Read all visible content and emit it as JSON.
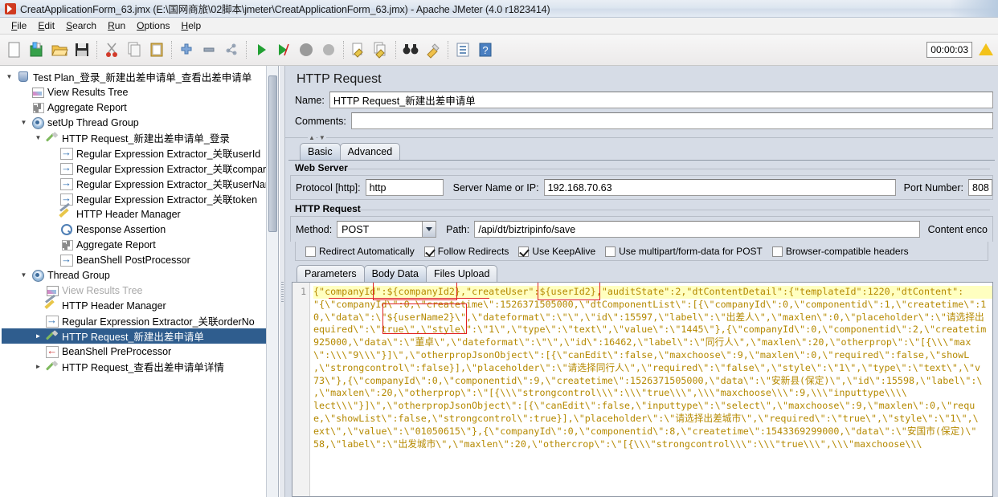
{
  "window": {
    "title": "CreatApplicationForm_63.jmx (E:\\国网商旅\\02脚本\\jmeter\\CreatApplicationForm_63.jmx) - Apache JMeter (4.0 r1823414)",
    "app_icon": "jmeter-icon"
  },
  "menubar": {
    "items": [
      {
        "label": "File",
        "mnemonic": "F"
      },
      {
        "label": "Edit",
        "mnemonic": "E"
      },
      {
        "label": "Search",
        "mnemonic": "S"
      },
      {
        "label": "Run",
        "mnemonic": "R"
      },
      {
        "label": "Options",
        "mnemonic": "O"
      },
      {
        "label": "Help",
        "mnemonic": "H"
      }
    ]
  },
  "toolbar": {
    "buttons": [
      {
        "name": "new-icon",
        "glyph": "page"
      },
      {
        "name": "templates-icon",
        "glyph": "templates"
      },
      {
        "name": "open-icon",
        "glyph": "folder"
      },
      {
        "name": "save-icon",
        "glyph": "floppy"
      },
      {
        "name": "cut-icon",
        "glyph": "scissors"
      },
      {
        "name": "copy-icon",
        "glyph": "copy"
      },
      {
        "name": "paste-icon",
        "glyph": "clipboard"
      },
      {
        "name": "expand-all-icon",
        "glyph": "plus"
      },
      {
        "name": "collapse-all-icon",
        "glyph": "minus"
      },
      {
        "name": "toggle-icon",
        "glyph": "toggle"
      },
      {
        "name": "start-icon",
        "glyph": "play"
      },
      {
        "name": "start-no-pauses-icon",
        "glyph": "play-no-pause"
      },
      {
        "name": "stop-icon",
        "glyph": "stop"
      },
      {
        "name": "shutdown-icon",
        "glyph": "shutdown"
      },
      {
        "name": "clear-icon",
        "glyph": "broom-page"
      },
      {
        "name": "clear-all-icon",
        "glyph": "broom-pages"
      },
      {
        "name": "search-icon",
        "glyph": "binoculars"
      },
      {
        "name": "reset-search-icon",
        "glyph": "brush"
      },
      {
        "name": "function-helper-icon",
        "glyph": "list"
      },
      {
        "name": "help-icon",
        "glyph": "question"
      }
    ],
    "timer": "00:00:03",
    "warning_icon": "warning-triangle-icon"
  },
  "tree": {
    "nodes": [
      {
        "label": "Test Plan_登录_新建出差申请单_查看出差申请单",
        "indent": 0,
        "twisty": "down",
        "icon": "test-plan-icon",
        "selected": false,
        "disabled": false
      },
      {
        "label": "View Results Tree",
        "indent": 1,
        "twisty": "none",
        "icon": "view-results-tree-icon",
        "selected": false,
        "disabled": false
      },
      {
        "label": "Aggregate Report",
        "indent": 1,
        "twisty": "none",
        "icon": "aggregate-report-icon",
        "selected": false,
        "disabled": false
      },
      {
        "label": "setUp Thread Group",
        "indent": 1,
        "twisty": "down",
        "icon": "thread-group-icon",
        "selected": false,
        "disabled": false
      },
      {
        "label": "HTTP Request_新建出差申请单_登录",
        "indent": 2,
        "twisty": "down",
        "icon": "http-request-icon",
        "selected": false,
        "disabled": false
      },
      {
        "label": "Regular Expression Extractor_关联userId",
        "indent": 3,
        "twisty": "none",
        "icon": "post-processor-icon",
        "selected": false,
        "disabled": false
      },
      {
        "label": "Regular Expression Extractor_关联companyId",
        "indent": 3,
        "twisty": "none",
        "icon": "post-processor-icon",
        "selected": false,
        "disabled": false
      },
      {
        "label": "Regular Expression Extractor_关联userName",
        "indent": 3,
        "twisty": "none",
        "icon": "post-processor-icon",
        "selected": false,
        "disabled": false
      },
      {
        "label": "Regular Expression Extractor_关联token",
        "indent": 3,
        "twisty": "none",
        "icon": "post-processor-icon",
        "selected": false,
        "disabled": false
      },
      {
        "label": "HTTP Header Manager",
        "indent": 3,
        "twisty": "none",
        "icon": "header-manager-icon",
        "selected": false,
        "disabled": false
      },
      {
        "label": "Response Assertion",
        "indent": 3,
        "twisty": "none",
        "icon": "assertion-icon",
        "selected": false,
        "disabled": false
      },
      {
        "label": "Aggregate Report",
        "indent": 3,
        "twisty": "none",
        "icon": "aggregate-report-icon",
        "selected": false,
        "disabled": false
      },
      {
        "label": "BeanShell PostProcessor",
        "indent": 3,
        "twisty": "none",
        "icon": "post-processor-icon",
        "selected": false,
        "disabled": false
      },
      {
        "label": "Thread Group",
        "indent": 1,
        "twisty": "down",
        "icon": "thread-group-icon",
        "selected": false,
        "disabled": false
      },
      {
        "label": "View Results Tree",
        "indent": 2,
        "twisty": "none",
        "icon": "view-results-tree-icon",
        "selected": false,
        "disabled": true
      },
      {
        "label": "HTTP Header Manager",
        "indent": 2,
        "twisty": "none",
        "icon": "header-manager-icon",
        "selected": false,
        "disabled": false
      },
      {
        "label": "Regular Expression Extractor_关联orderNo",
        "indent": 2,
        "twisty": "none",
        "icon": "post-processor-icon",
        "selected": false,
        "disabled": false
      },
      {
        "label": "HTTP Request_新建出差申请单",
        "indent": 2,
        "twisty": "right",
        "icon": "http-request-icon",
        "selected": true,
        "disabled": false
      },
      {
        "label": "BeanShell PreProcessor",
        "indent": 2,
        "twisty": "none",
        "icon": "pre-processor-icon",
        "selected": false,
        "disabled": false
      },
      {
        "label": "HTTP Request_查看出差申请单详情",
        "indent": 2,
        "twisty": "right",
        "icon": "http-request-icon",
        "selected": false,
        "disabled": false
      }
    ]
  },
  "panel": {
    "title": "HTTP Request",
    "name_label": "Name:",
    "name_value": "HTTP Request_新建出差申请单",
    "comments_label": "Comments:",
    "comments_value": "",
    "tabs": [
      {
        "label": "Basic",
        "active": true
      },
      {
        "label": "Advanced",
        "active": false
      }
    ],
    "web_server": {
      "section_title": "Web Server",
      "protocol_label": "Protocol [http]:",
      "protocol_value": "http",
      "server_label": "Server Name or IP:",
      "server_value": "192.168.70.63",
      "port_label": "Port Number:",
      "port_value": "808"
    },
    "http_request": {
      "section_title": "HTTP Request",
      "method_label": "Method:",
      "method_value": "POST",
      "path_label": "Path:",
      "path_value": "/api/dt/biztripinfo/save",
      "content_encoding_label": "Content enco"
    },
    "checkboxes": [
      {
        "label": "Redirect Automatically",
        "checked": false
      },
      {
        "label": "Follow Redirects",
        "checked": true
      },
      {
        "label": "Use KeepAlive",
        "checked": true
      },
      {
        "label": "Use multipart/form-data for POST",
        "checked": false
      },
      {
        "label": "Browser-compatible headers",
        "checked": false
      }
    ],
    "data_tabs": [
      {
        "label": "Parameters",
        "active": false
      },
      {
        "label": "Body Data",
        "active": true
      },
      {
        "label": "Files Upload",
        "active": false
      }
    ]
  },
  "body_editor": {
    "line_number": "1",
    "lines": [
      "{\"companyId\":${companyId2},\"createUser\":${userId2},\"auditState\":2,\"dtContentDetail\":{\"templateId\":1220,\"dtContent\":",
      "\"{\\\"companyId\\\":0,\\\"createtime\\\":1526371505000,\\\"dtComponentList\\\":[{\\\"companyId\\\":0,\\\"componentid\\\":1,\\\"createtime\\\":1",
      "0,\\\"data\\\":\\\"${userName2}\\\",\\\"dateformat\\\":\\\"\\\",\\\"id\\\":15597,\\\"label\\\":\\\"出差人\\\",\\\"maxlen\\\":0,\\\"placeholder\\\":\\\"请选择出",
      "equired\\\":\\\"true\\\",\\\"style\\\":\\\"1\\\",\\\"type\\\":\\\"text\\\",\\\"value\\\":\\\"1445\\\"},{\\\"companyId\\\":0,\\\"componentid\\\":2,\\\"createtim",
      "925000,\\\"data\\\":\\\"董卓\\\",\\\"dateformat\\\":\\\"\\\",\\\"id\\\":16462,\\\"label\\\":\\\"同行人\\\",\\\"maxlen\\\":20,\\\"otherprop\\\":\\\"[{\\\\\\\"max",
      "\\\":\\\\\\\"9\\\\\\\"}]\\\",\\\"otherpropJsonObject\\\":[{\\\"canEdit\\\":false,\\\"maxchoose\\\":9,\\\"maxlen\\\":0,\\\"required\\\":false,\\\"showL",
      ",\\\"strongcontrol\\\":false}],\\\"placeholder\\\":\\\"请选择同行人\\\",\\\"required\\\":\\\"false\\\",\\\"style\\\":\\\"1\\\",\\\"type\\\":\\\"text\\\",\\\"v",
      "73\\\"},{\\\"companyId\\\":0,\\\"componentid\\\":9,\\\"createtime\\\":1526371505000,\\\"data\\\":\\\"安新县(保定)\\\",\\\"id\\\":15598,\\\"label\\\":\\",
      ",\\\"maxlen\\\":20,\\\"otherprop\\\":\\\"[{\\\\\\\"strongcontrol\\\\\\\":\\\\\\\"true\\\\\\\",\\\\\\\"maxchoose\\\\\\\":9,\\\\\\\"inputtype\\\\\\\\",
      "lect\\\\\\\"}]\\\",\\\"otherpropJsonObject\\\":[{\\\"canEdit\\\":false,\\\"inputtype\\\":\\\"select\\\",\\\"maxchoose\\\":9,\\\"maxlen\\\":0,\\\"requ",
      "e,\\\"showList\\\":false,\\\"strongcontrol\\\":true}],\\\"placeholder\\\":\\\"请选择出差城市\\\",\\\"required\\\":\\\"true\\\",\\\"style\\\":\\\"1\\\",\\",
      "ext\\\",\\\"value\\\":\\\"01050615\\\"},{\\\"companyId\\\":0,\\\"componentid\\\":8,\\\"createtime\\\":1543369299000,\\\"data\\\":\\\"安国市(保定)\\\"",
      "58,\\\"label\\\":\\\"出发城市\\\",\\\"maxlen\\\":20,\\\"othercrop\\\":\\\"[{\\\\\\\"strongcontrol\\\\\\\":\\\\\\\"true\\\\\\\",\\\\\\\"maxchoose\\\\\\"
    ],
    "annotations": [
      {
        "name": "companyId-variable-box"
      },
      {
        "name": "userId-variable-box"
      },
      {
        "name": "userName-variable-box"
      },
      {
        "name": "createtime-strikethrough"
      }
    ]
  }
}
